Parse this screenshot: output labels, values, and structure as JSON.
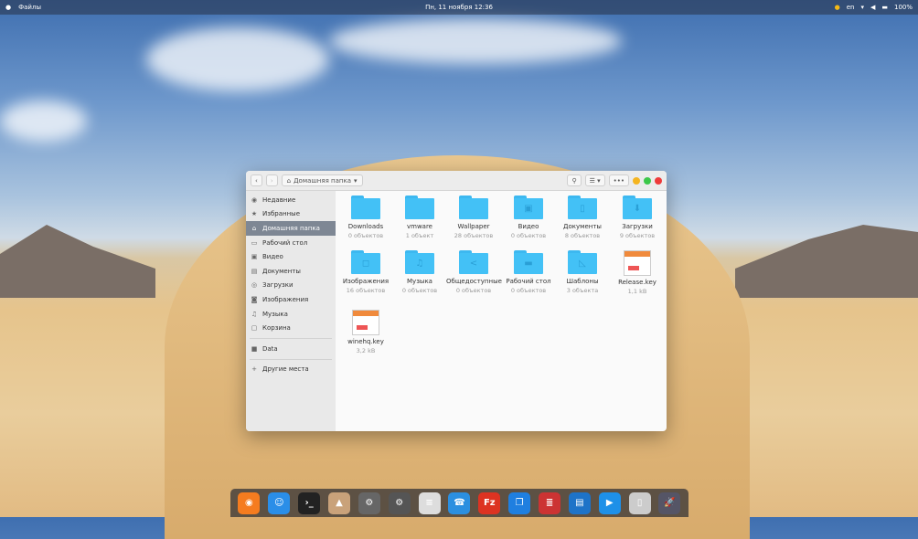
{
  "topbar": {
    "app": "Файлы",
    "datetime": "Пн, 11 ноября 12:36",
    "lang": "en",
    "battery": "100%"
  },
  "window": {
    "location": "Домашняя папка"
  },
  "sidebar": {
    "items": [
      {
        "label": "Недавние",
        "icon": "clock-icon"
      },
      {
        "label": "Избранные",
        "icon": "star-icon"
      },
      {
        "label": "Домашняя папка",
        "icon": "home-icon",
        "active": true
      },
      {
        "label": "Рабочий стол",
        "icon": "desktop-icon"
      },
      {
        "label": "Видео",
        "icon": "video-icon"
      },
      {
        "label": "Документы",
        "icon": "documents-icon"
      },
      {
        "label": "Загрузки",
        "icon": "download-icon"
      },
      {
        "label": "Изображения",
        "icon": "camera-icon"
      },
      {
        "label": "Музыка",
        "icon": "music-icon"
      },
      {
        "label": "Корзина",
        "icon": "trash-icon"
      }
    ],
    "data": "Data",
    "other": "Другие места"
  },
  "files": [
    {
      "name": "Downloads",
      "info": "0 объектов"
    },
    {
      "name": "vmware",
      "info": "1 объект"
    },
    {
      "name": "Wallpaper",
      "info": "28 объектов"
    },
    {
      "name": "Видео",
      "info": "0 объектов"
    },
    {
      "name": "Документы",
      "info": "8 объектов"
    },
    {
      "name": "Загрузки",
      "info": "9 объектов"
    },
    {
      "name": "Изображения",
      "info": "16 объектов"
    },
    {
      "name": "Музыка",
      "info": "0 объектов"
    },
    {
      "name": "Общедоступные",
      "info": "0 объектов"
    },
    {
      "name": "Рабочий стол",
      "info": "0 объектов"
    },
    {
      "name": "Шаблоны",
      "info": "3 объекта"
    },
    {
      "name": "Release.key",
      "info": "1,1 kB"
    },
    {
      "name": "winehq.key",
      "info": "3,2 kB"
    }
  ],
  "dock": [
    "firefox",
    "finder",
    "terminal",
    "installer",
    "system-settings",
    "settings",
    "text-editor",
    "vpn",
    "filezilla",
    "virtualbox",
    "library",
    "writer",
    "media-player",
    "trash",
    "launchpad"
  ]
}
